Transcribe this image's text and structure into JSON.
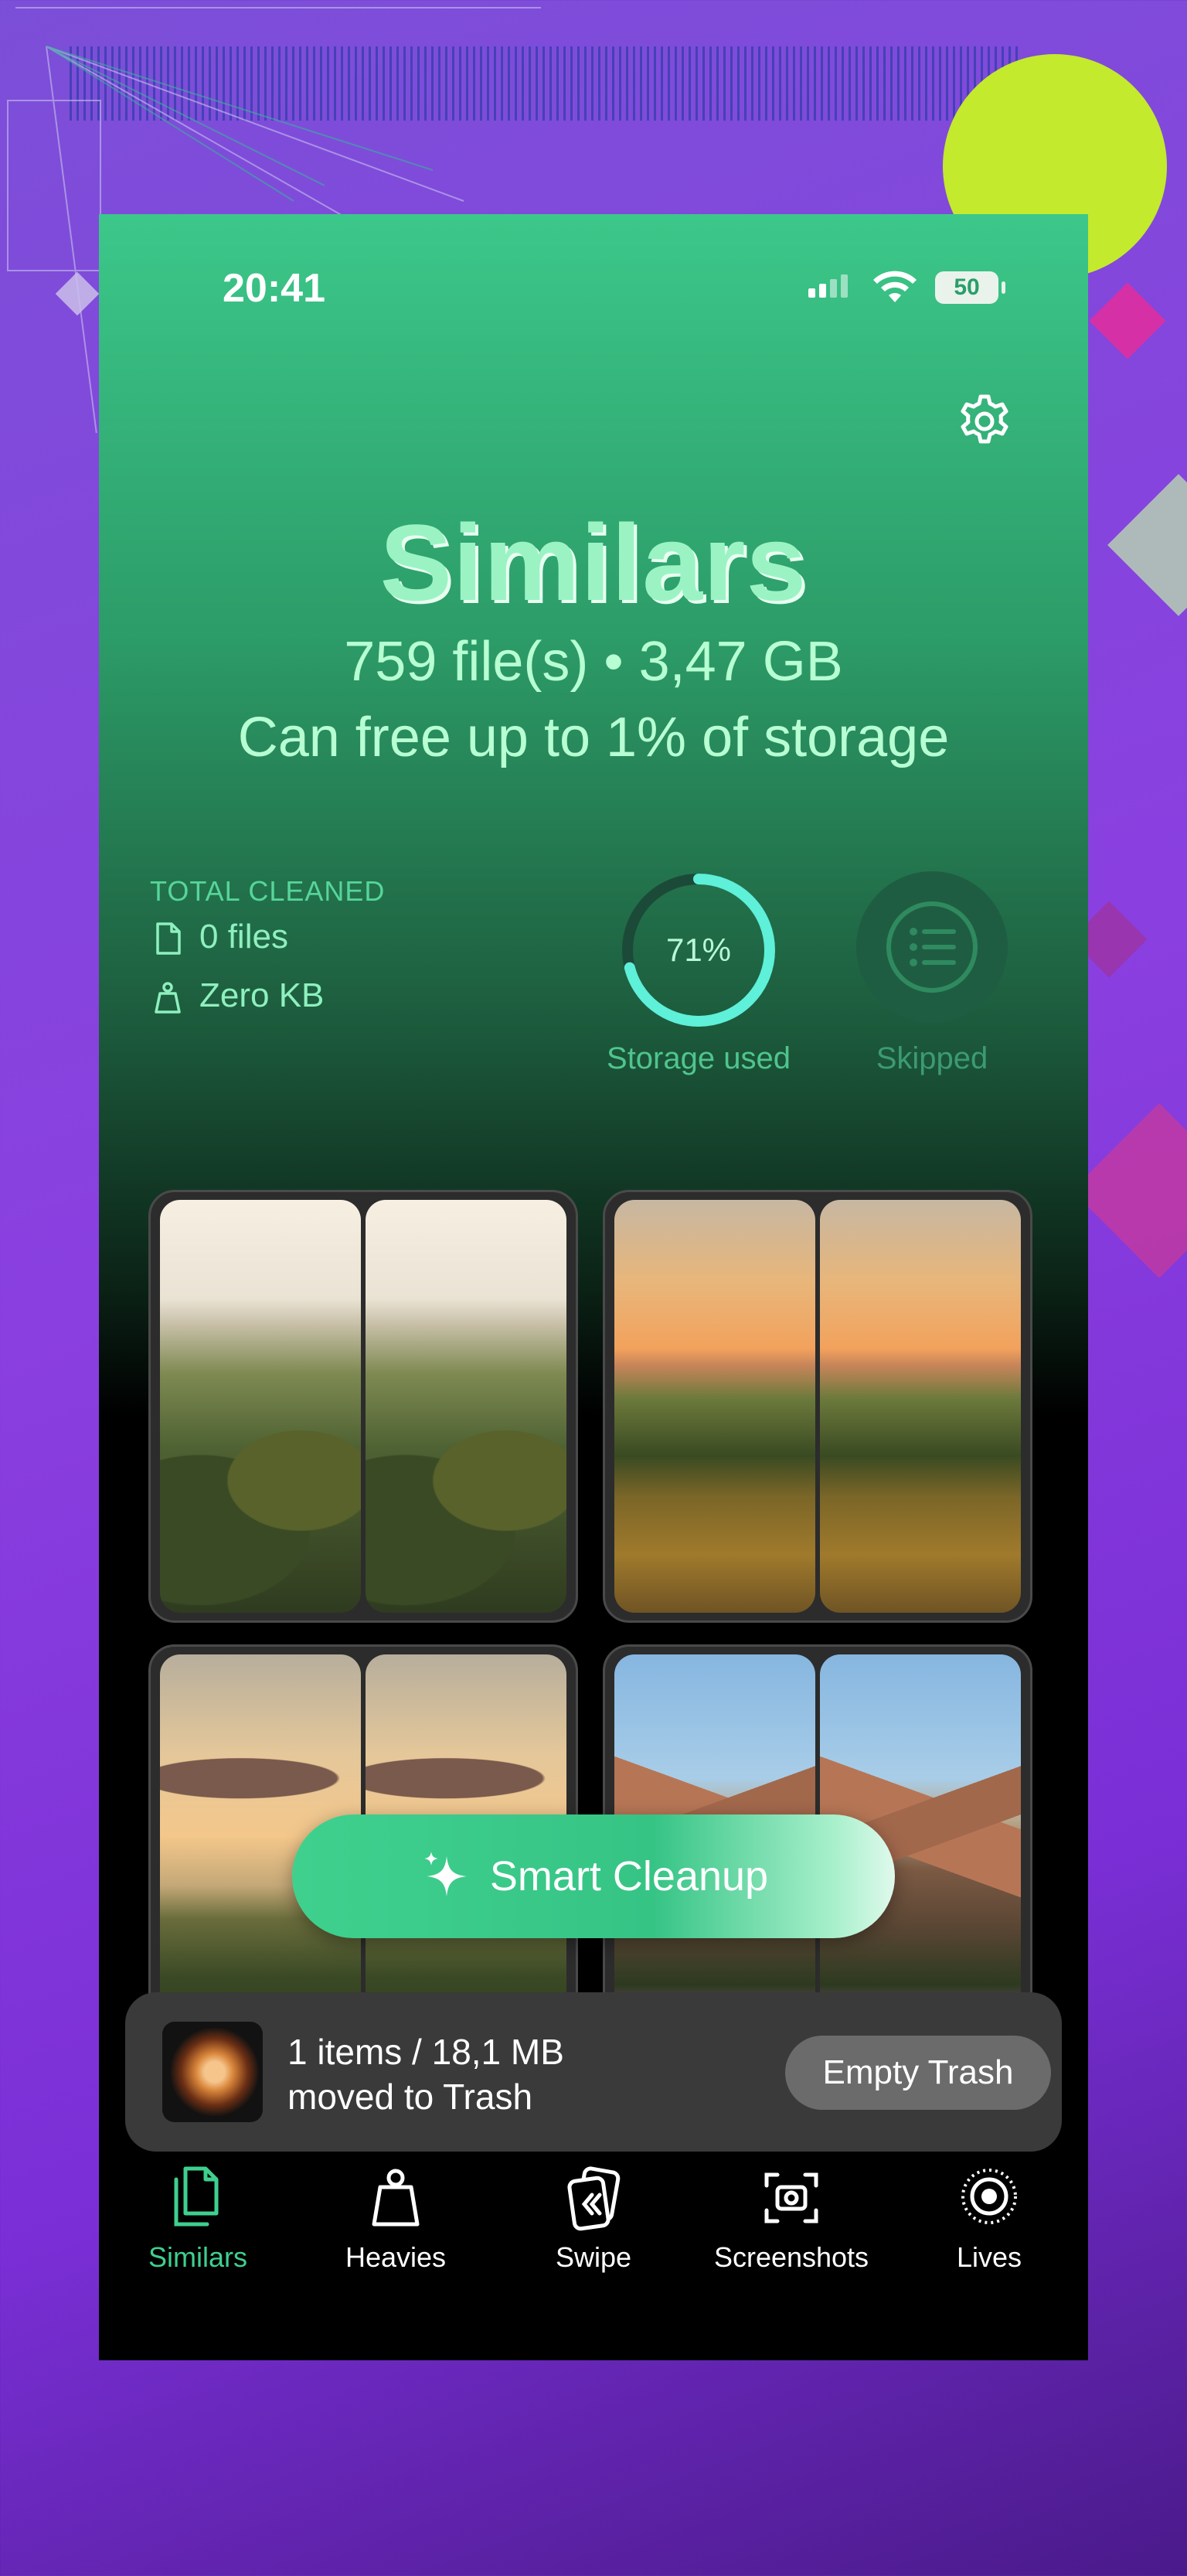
{
  "status_bar": {
    "time": "20:41",
    "battery": "50"
  },
  "header": {
    "title": "Similars",
    "summary": "759 file(s) • 3,47 GB",
    "storage_note": "Can free up to 1% of storage"
  },
  "total_cleaned": {
    "label": "TOTAL CLEANED",
    "files": "0 files",
    "size": "Zero KB"
  },
  "storage": {
    "percent_text": "71%",
    "percent_value": 0.71,
    "label": "Storage used"
  },
  "skipped": {
    "label": "Skipped"
  },
  "groups": [
    {
      "name": "rolling-hills-pair"
    },
    {
      "name": "sunset-field-pair"
    },
    {
      "name": "evening-sky-pair"
    },
    {
      "name": "mountain-peak-pair"
    }
  ],
  "cta": {
    "label": "Smart Cleanup"
  },
  "trash_toast": {
    "line1": "1 items / 18,1 MB",
    "line2": "moved to Trash",
    "button": "Empty Trash"
  },
  "tabs": [
    {
      "label": "Similars",
      "icon": "similars-icon",
      "active": true
    },
    {
      "label": "Heavies",
      "icon": "weight-icon"
    },
    {
      "label": "Swipe",
      "icon": "swipe-icon"
    },
    {
      "label": "Screenshots",
      "icon": "screenshot-icon"
    },
    {
      "label": "Lives",
      "icon": "live-photo-icon"
    }
  ],
  "colors": {
    "accent": "#3fcf8e",
    "title": "#9bf3c4",
    "background_purple": "#8a3fe0"
  }
}
